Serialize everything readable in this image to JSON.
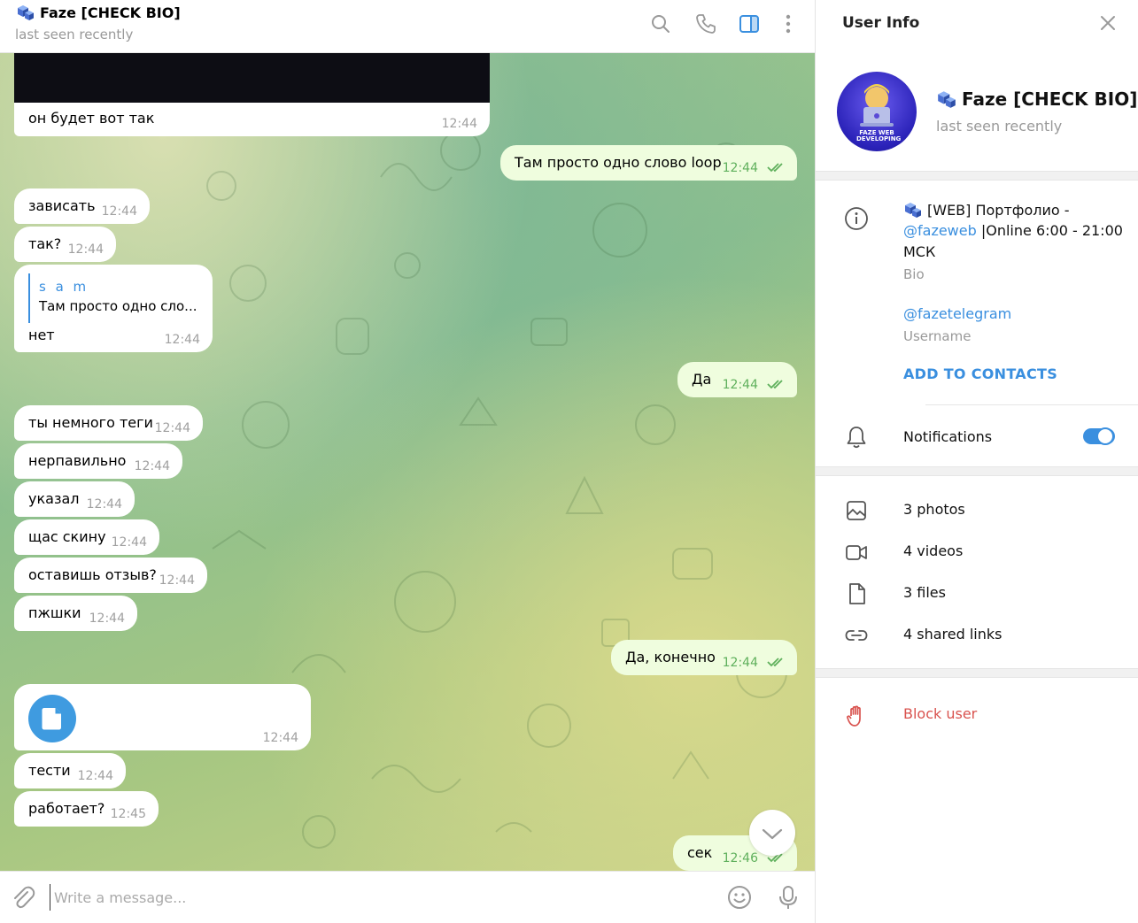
{
  "chat": {
    "title": "Faze [CHECK BIO]",
    "status": "last seen recently",
    "composer_placeholder": "Write a message..."
  },
  "messages": [
    {
      "dir": "in",
      "text": "он будет вот так",
      "time": "12:44"
    },
    {
      "dir": "out",
      "text": "Там просто одно слово loop",
      "time": "12:44"
    },
    {
      "dir": "in",
      "text": "зависать",
      "time": "12:44"
    },
    {
      "dir": "in",
      "text": "так?",
      "time": "12:44"
    },
    {
      "dir": "in",
      "reply_name": "s a m",
      "reply_text": "Там просто одно сло...",
      "text": "нет",
      "time": "12:44"
    },
    {
      "dir": "out",
      "text": "Да",
      "time": "12:44"
    },
    {
      "dir": "in",
      "text": "ты немного теги",
      "time": "12:44"
    },
    {
      "dir": "in",
      "text": "нерпавильно",
      "time": "12:44"
    },
    {
      "dir": "in",
      "text": "указал",
      "time": "12:44"
    },
    {
      "dir": "in",
      "text": "щас скину",
      "time": "12:44"
    },
    {
      "dir": "in",
      "text": "оставишь отзыв?",
      "time": "12:44"
    },
    {
      "dir": "in",
      "text": "пжшки",
      "time": "12:44"
    },
    {
      "dir": "out",
      "text": "Да, конечно",
      "time": "12:44"
    },
    {
      "dir": "in",
      "text": "",
      "time": "12:44",
      "kind": "file"
    },
    {
      "dir": "in",
      "text": "тести",
      "time": "12:44"
    },
    {
      "dir": "in",
      "text": "работает?",
      "time": "12:45"
    },
    {
      "dir": "out",
      "text": "сек",
      "time": "12:46"
    }
  ],
  "panel": {
    "title": "User Info",
    "name": "Faze [CHECK BIO]",
    "status": "last seen recently",
    "avatar_text": "FAZE WEB DEVELOPING",
    "bio_line1": "[WEB] Портфолио -",
    "bio_link": "@fazeweb",
    "bio_line2_rest": " |Online 6:00 - 21:00",
    "bio_line3": "МСК",
    "bio_label": "Bio",
    "username": "@fazetelegram",
    "username_label": "Username",
    "add_contacts": "ADD TO CONTACTS",
    "notifications": "Notifications",
    "notifications_on": true,
    "media": [
      {
        "icon": "photo-icon",
        "label": "3 photos"
      },
      {
        "icon": "video-icon",
        "label": "4 videos"
      },
      {
        "icon": "file-icon",
        "label": "3 files"
      },
      {
        "icon": "link-icon",
        "label": "4 shared links"
      }
    ],
    "block": "Block user"
  },
  "colors": {
    "accent": "#3a8fdf",
    "outgoing_bubble": "#effdde",
    "read_check": "#5fb05c",
    "danger": "#d9534f"
  }
}
